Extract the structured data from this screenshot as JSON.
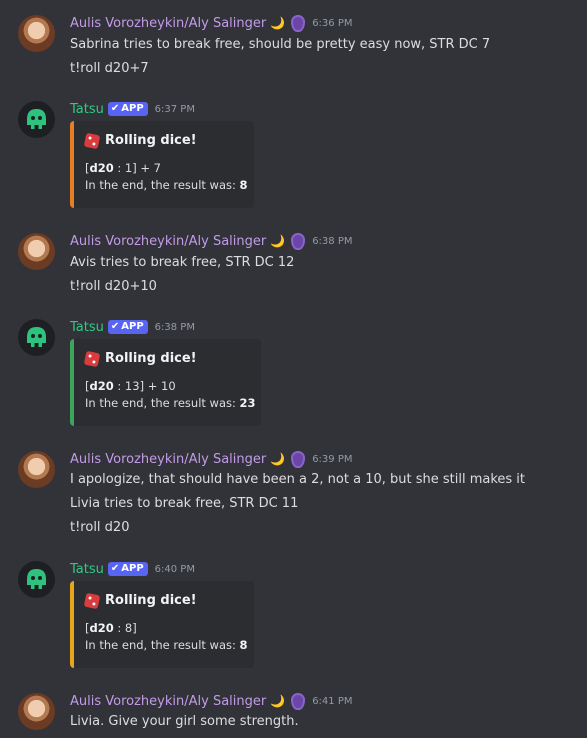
{
  "messages": [
    {
      "type": "user",
      "username": "Aulis Vorozheykin/Aly Salinger",
      "time": "6:36 PM",
      "lines": [
        "Sabrina tries to break free, should be pretty easy now, STR DC 7",
        "t!roll d20+7"
      ]
    },
    {
      "type": "bot",
      "username": "Tatsu",
      "badge": "APP",
      "time": "6:37 PM",
      "embed": {
        "title": "Rolling dice!",
        "die_label": "d20",
        "roll_rest": " : 1] + 7",
        "result_prefix": "In the end, the result was: ",
        "result": "8",
        "accent": "#e67e22"
      }
    },
    {
      "type": "user",
      "username": "Aulis Vorozheykin/Aly Salinger",
      "time": "6:38 PM",
      "lines": [
        "Avis tries to break free, STR DC 12",
        "t!roll d20+10"
      ]
    },
    {
      "type": "bot",
      "username": "Tatsu",
      "badge": "APP",
      "time": "6:38 PM",
      "embed": {
        "title": "Rolling dice!",
        "die_label": "d20",
        "roll_rest": " : 13] + 10",
        "result_prefix": "In the end, the result was: ",
        "result": "23",
        "accent": "#3ba55c"
      }
    },
    {
      "type": "user",
      "username": "Aulis Vorozheykin/Aly Salinger",
      "time": "6:39 PM",
      "lines": [
        "I apologize, that should have been a 2, not a 10, but she still makes it",
        "Livia tries to break free, STR DC 11",
        "t!roll d20"
      ]
    },
    {
      "type": "bot",
      "username": "Tatsu",
      "badge": "APP",
      "time": "6:40 PM",
      "embed": {
        "title": "Rolling dice!",
        "die_label": "d20",
        "roll_rest": " : 8]",
        "result_prefix": "In the end, the result was: ",
        "result": "8",
        "accent": "#e6a619"
      }
    },
    {
      "type": "user",
      "username": "Aulis Vorozheykin/Aly Salinger",
      "time": "6:41 PM",
      "lines": [
        "Livia. Give your girl some strength."
      ]
    }
  ],
  "icons": {
    "moon": "crescent-moon-icon",
    "shield": "shield-role-icon",
    "die": "die-icon",
    "check": "checkmark-icon"
  }
}
